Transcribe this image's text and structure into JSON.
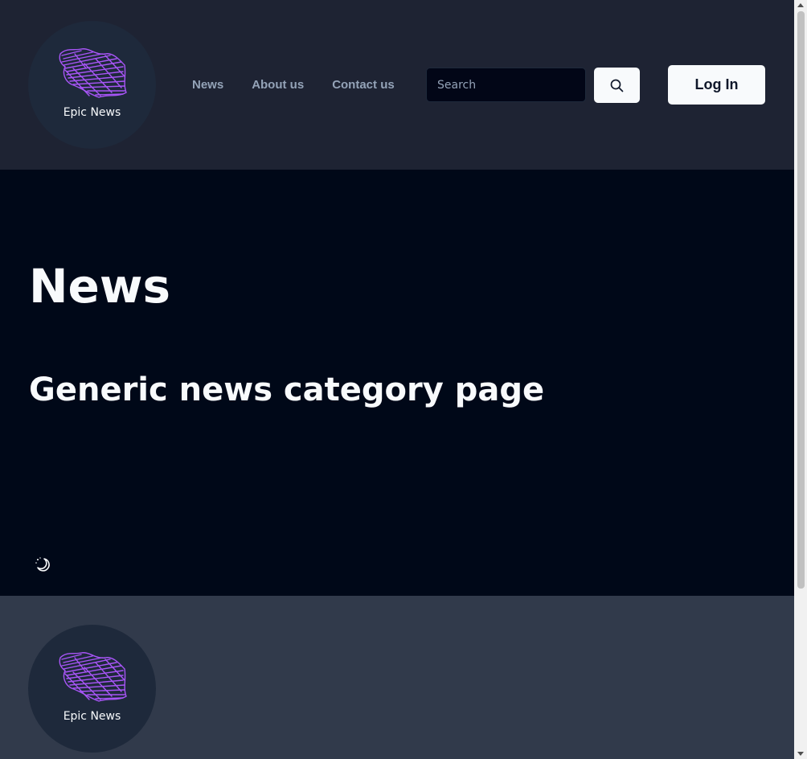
{
  "brand": {
    "name": "Epic News"
  },
  "nav": {
    "items": [
      "News",
      "About us",
      "Contact us"
    ]
  },
  "search": {
    "placeholder": "Search"
  },
  "auth": {
    "login_label": "Log In"
  },
  "main": {
    "title": "News",
    "subtitle": "Generic news category page"
  },
  "footer": {
    "brand_name": "Epic News"
  },
  "icons": {
    "logo": "brand-logo-scribble-icon",
    "search": "search-icon",
    "theme": "moon-stars-icon"
  },
  "colors": {
    "header_bg": "#1e2333",
    "main_bg": "#000818",
    "footer_bg": "#313a4b",
    "accent": "#a855f7",
    "text": "#f8fafc",
    "nav_text": "#94a3b8"
  }
}
